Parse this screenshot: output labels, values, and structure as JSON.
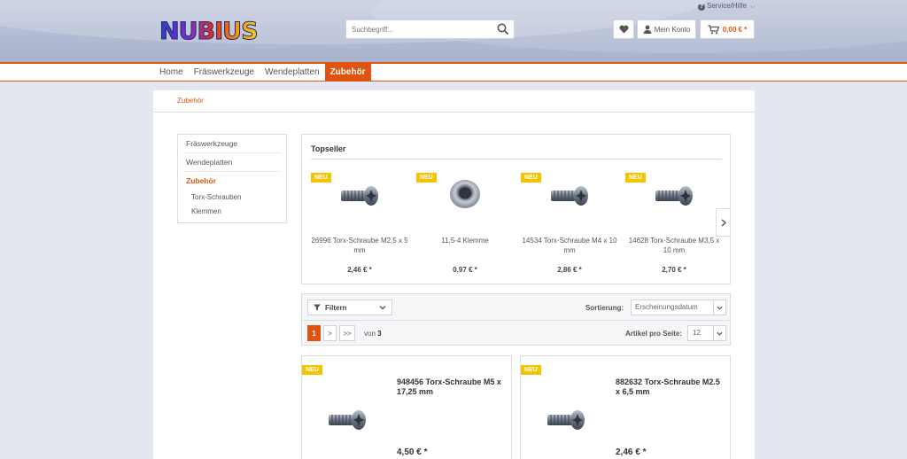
{
  "header": {
    "logo": "NUBIUS",
    "service_label": "Service/Hilfe",
    "search_placeholder": "Suchbegriff...",
    "account_label": "Mein Konto",
    "cart_amount": "0,00 € *"
  },
  "nav": {
    "items": [
      {
        "label": "Home"
      },
      {
        "label": "Fräswerkzeuge"
      },
      {
        "label": "Wendeplatten"
      },
      {
        "label": "Zubehör"
      }
    ],
    "active": "Zubehör"
  },
  "breadcrumb": "Zubehör",
  "sidebar": {
    "items": [
      {
        "label": "Fräswerkzeuge"
      },
      {
        "label": "Wendeplatten"
      },
      {
        "label": "Zubehör"
      }
    ],
    "subitems": [
      {
        "label": "Torx-Schrauben"
      },
      {
        "label": "Klemmen"
      }
    ]
  },
  "topseller": {
    "title": "Topseller",
    "products": [
      {
        "badge": "NEU",
        "name": "26996 Torx-Schraube M2,5 x 5 mm",
        "price": "2,46 € *",
        "icon": "torx-screw"
      },
      {
        "badge": "NEU",
        "name": "11,5-4 Klemme",
        "price": "0,97 € *",
        "icon": "clamp-washer"
      },
      {
        "badge": "NEU",
        "name": "14534 Torx-Schraube M4 x 10 mm",
        "price": "2,86 € *",
        "icon": "torx-screw"
      },
      {
        "badge": "NEU",
        "name": "14628 Torx-Schraube M3,5 x 10 mm",
        "price": "2,70 € *",
        "icon": "torx-screw"
      }
    ]
  },
  "listing": {
    "filter_label": "Filtern",
    "sort_label": "Sortierung:",
    "sort_value": "Erscheinungsdatum",
    "page_current": "1",
    "page_next": ">",
    "page_last": ">>",
    "page_of_label": "von",
    "page_total": "3",
    "per_page_label": "Artikel pro Seite:",
    "per_page_value": "12",
    "products": [
      {
        "badge": "NEU",
        "name": "948456 Torx-Schraube M5 x 17,25 mm",
        "price": "4,50 € *",
        "icon": "torx-screw"
      },
      {
        "badge": "NEU",
        "name": "882632 Torx-Schraube M2.5 x 6,5 mm",
        "price": "2,46 € *",
        "icon": "torx-screw"
      }
    ]
  },
  "colors": {
    "accent": "#e1540f",
    "badge": "#f5c400",
    "background": "#e4e7ef"
  }
}
